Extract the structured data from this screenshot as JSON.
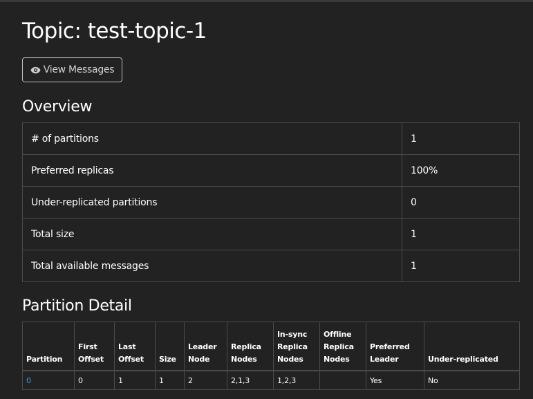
{
  "page": {
    "title": "Topic: test-topic-1"
  },
  "toolbar": {
    "view_messages_label": "View Messages"
  },
  "overview": {
    "heading": "Overview",
    "rows": [
      {
        "label": "# of partitions",
        "value": "1"
      },
      {
        "label": "Preferred replicas",
        "value": "100%"
      },
      {
        "label": "Under-replicated partitions",
        "value": "0"
      },
      {
        "label": "Total size",
        "value": "1"
      },
      {
        "label": "Total available messages",
        "value": "1"
      }
    ]
  },
  "partition_detail": {
    "heading": "Partition Detail",
    "columns": [
      [
        "Partition"
      ],
      [
        "First",
        "Offset"
      ],
      [
        "Last",
        "Offset"
      ],
      [
        "Size"
      ],
      [
        "Leader",
        "Node"
      ],
      [
        "Replica",
        "Nodes"
      ],
      [
        "In-sync",
        "Replica",
        "Nodes"
      ],
      [
        "Offline",
        "Replica",
        "Nodes"
      ],
      [
        "Preferred",
        "Leader"
      ],
      [
        "Under-replicated"
      ]
    ],
    "rows": [
      [
        "0",
        "0",
        "1",
        "1",
        "2",
        "2,1,3",
        "1,2,3",
        "",
        "Yes",
        "No"
      ]
    ]
  },
  "colors": {
    "background": "#222222",
    "link": "#2fa4e7",
    "border": "#4a4a4a"
  }
}
